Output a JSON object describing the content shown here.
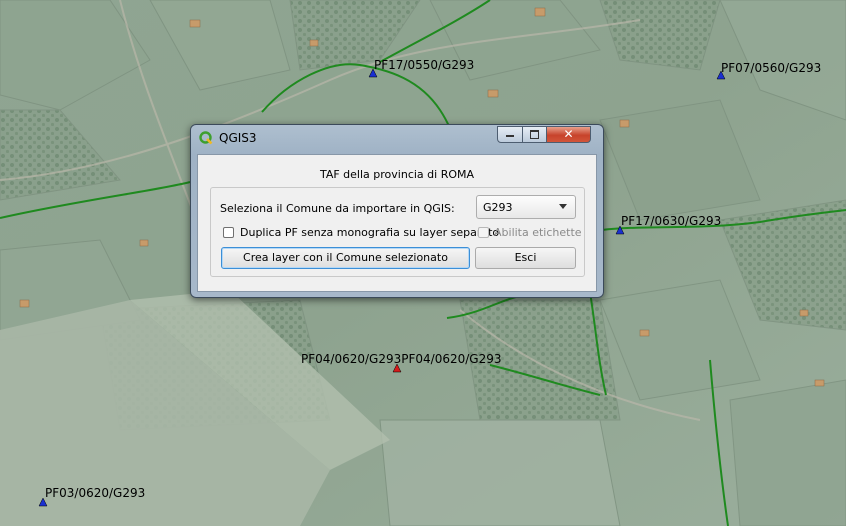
{
  "map": {
    "points": [
      {
        "label": "PF17/0550/G293",
        "color": "#1a2fd0"
      },
      {
        "label": "PF07/0560/G293",
        "color": "#1a2fd0"
      },
      {
        "label": "PF17/0630/G293",
        "color": "#1a2fd0"
      },
      {
        "label": "PF04/0620/G293PF04/0620/G293",
        "color": "#d41b1b"
      },
      {
        "label": "PF03/0620/G293",
        "color": "#1a2fd0"
      }
    ],
    "boundary_color": "#1f8a1f"
  },
  "dialog": {
    "title": "QGIS3",
    "minimize_icon": "minimize-icon",
    "maximize_icon": "maximize-icon",
    "close_icon": "close-icon",
    "close_glyph": "✕",
    "heading": "TAF della provincia di ROMA",
    "select_label": "Seleziona il Comune da importare in QGIS:",
    "comune_value": "G293",
    "duplicate_label": "Duplica PF senza monografia su layer separato",
    "labels_label": "Abilita etichette",
    "create_button": "Crea layer con il Comune selezionato",
    "exit_button": "Esci"
  }
}
